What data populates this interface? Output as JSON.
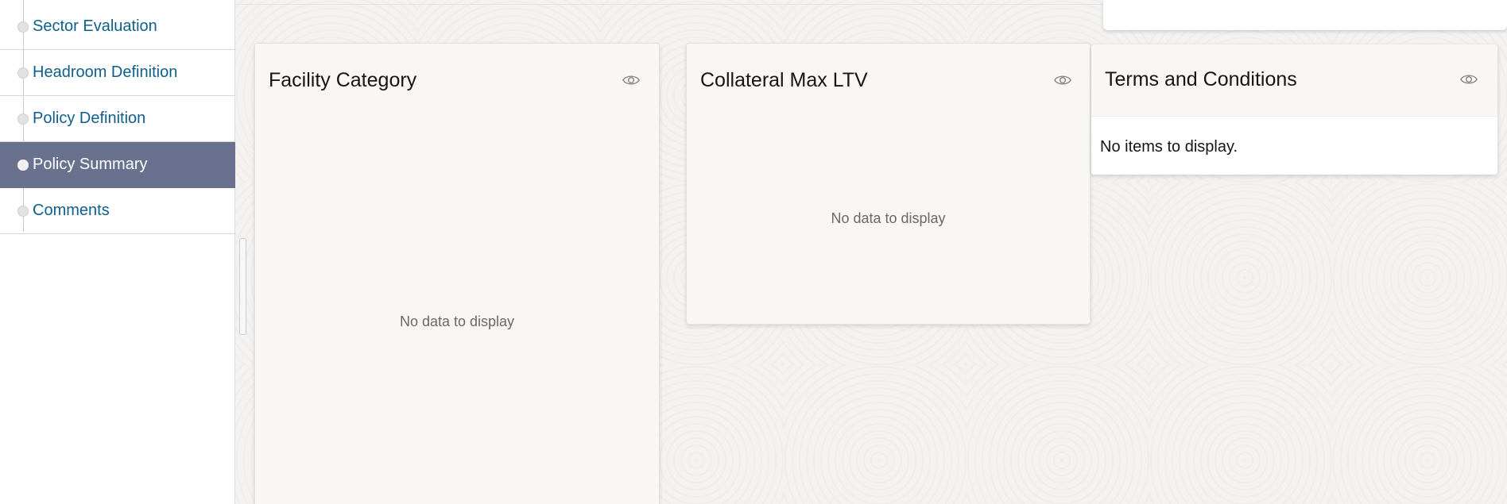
{
  "sidebar": {
    "items": [
      {
        "label": "Sector Evaluation",
        "active": false
      },
      {
        "label": "Headroom Definition",
        "active": false
      },
      {
        "label": "Policy Definition",
        "active": false
      },
      {
        "label": "Policy Summary",
        "active": true
      },
      {
        "label": "Comments",
        "active": false
      }
    ]
  },
  "cards": {
    "facility_category": {
      "title": "Facility Category",
      "empty_text": "No data to display",
      "icon": "eye-icon"
    },
    "collateral_max_ltv": {
      "title": "Collateral Max LTV",
      "empty_text": "No data to display",
      "icon": "eye-icon"
    },
    "terms_and_conditions": {
      "title": "Terms and Conditions",
      "empty_text": "No items to display.",
      "icon": "eye-icon"
    }
  },
  "colors": {
    "active_nav_bg": "#69718f",
    "nav_text": "#0f5f8c",
    "card_bg": "#f8f7f6"
  }
}
